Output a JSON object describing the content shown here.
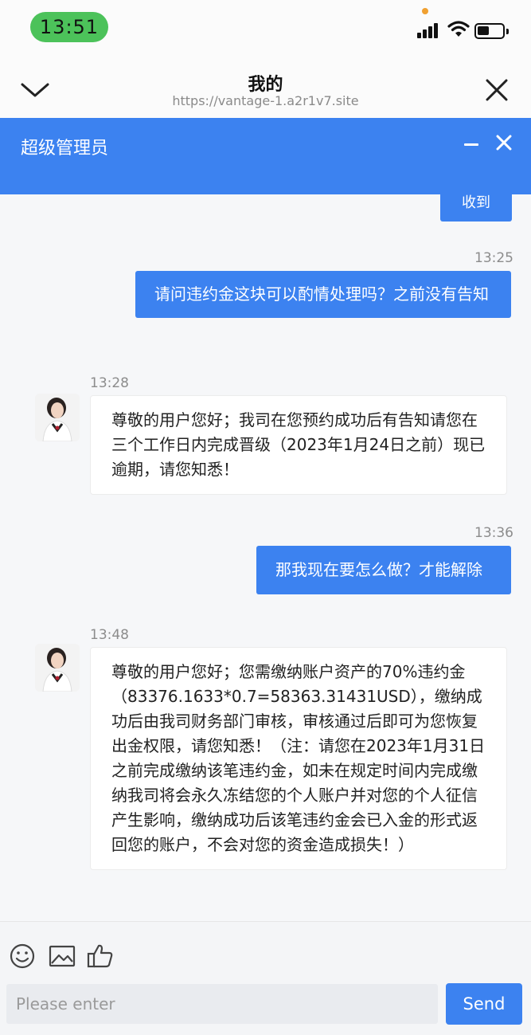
{
  "status_bar": {
    "time": "13:51"
  },
  "nav": {
    "title": "我的",
    "url": "https://vantage-1.a2r1v7.site"
  },
  "chat_header": {
    "title": "超级管理员"
  },
  "messages": {
    "cut_off_bubble_text": "收到",
    "m1": {
      "time": "13:25",
      "text": "请问违约金这块可以酌情处理吗？之前没有告知"
    },
    "m2": {
      "time": "13:28",
      "text": "尊敬的用户您好；我司在您预约成功后有告知请您在三个工作日内完成晋级（2023年1月24日之前）现已逾期，请您知悉！"
    },
    "m3": {
      "time": "13:36",
      "text": "那我现在要怎么做？才能解除"
    },
    "m4": {
      "time": "13:48",
      "text": "尊敬的用户您好；您需缴纳账户资产的70%违约金（83376.1633*0.7=58363.31431USD），缴纳成功后由我司财务部门审核，审核通过后即可为您恢复出金权限，请您知悉！（注：请您在2023年1月31日之前完成缴纳该笔违约金，如未在规定时间内完成缴纳我司将会永久冻结您的个人账户并对您的个人征信产生影响，缴纳成功后该笔违约金会已入金的形式返回您的账户，不会对您的资金造成损失！）"
    }
  },
  "composer": {
    "placeholder": "Please enter",
    "send_label": "Send"
  },
  "colors": {
    "brand_blue": "#3c82f0",
    "time_pill_green": "#4cc25a"
  },
  "icons": [
    "chevron-down-icon",
    "close-icon",
    "minimize-icon",
    "emoji-icon",
    "image-icon",
    "thumbs-up-icon",
    "signal-icon",
    "wifi-icon",
    "battery-icon"
  ]
}
